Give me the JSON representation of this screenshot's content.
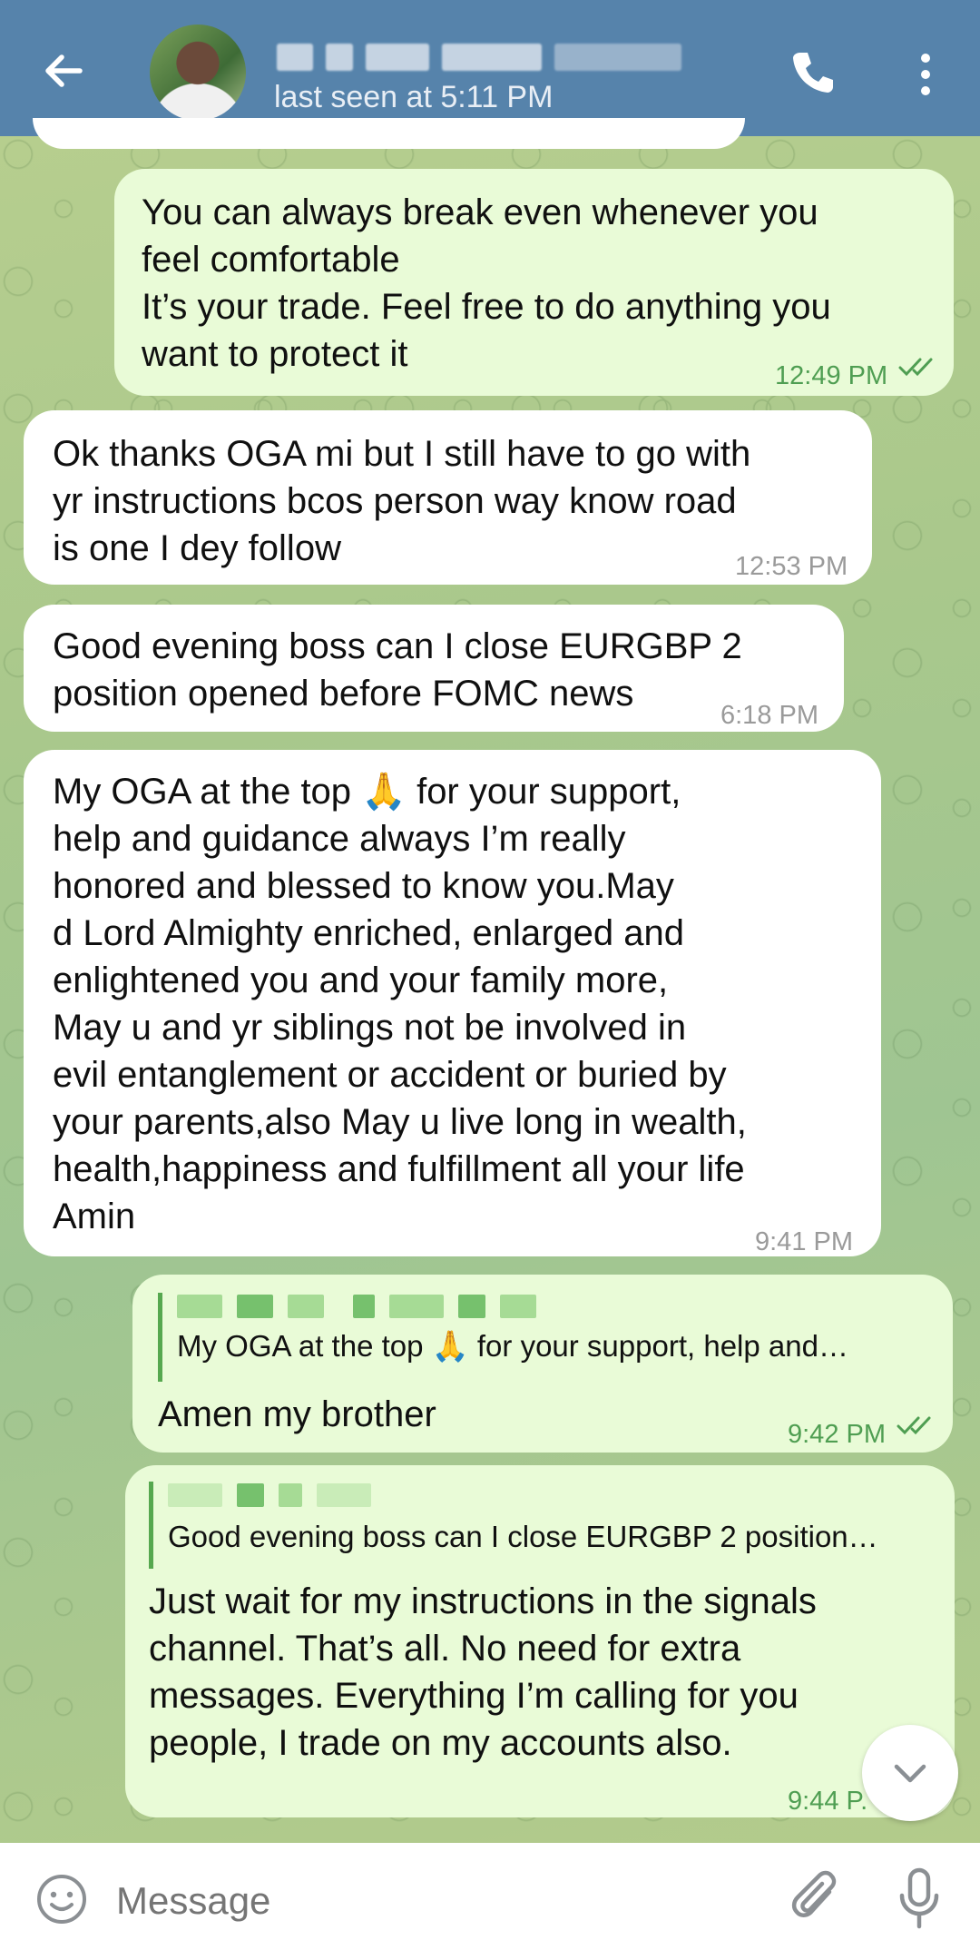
{
  "header": {
    "status": "last seen at 5:11 PM"
  },
  "messages": [
    {
      "text": "You can always break even whenever you\nfeel comfortable\nIt’s your trade. Feel free to do anything you\nwant to protect it",
      "time": "12:49 PM"
    },
    {
      "text": "Ok thanks OGA mi but I still have to go with\nyr instructions bcos person way know road\nis one I dey follow",
      "time": "12:53 PM"
    },
    {
      "text": "Good evening boss can I close EURGBP 2\nposition opened before FOMC news",
      "time": "6:18 PM"
    },
    {
      "text": "My OGA at the top 🙏 for your support,\nhelp and guidance always I’m really\nhonored and blessed to know you.May\nd Lord Almighty enriched, enlarged and\nenlightened you and your family more,\nMay u and yr siblings not be involved in\nevil entanglement or accident or buried by\nyour parents,also May u live long in wealth,\nhealth,happiness and fulfillment all your life\nAmin",
      "time": "9:41 PM"
    },
    {
      "reply": "My OGA at the top 🙏 for your support, help and…",
      "text": "Amen my brother",
      "time": "9:42 PM"
    },
    {
      "reply": "Good evening boss can I close EURGBP 2 position…",
      "text": "Just wait for my instructions in the signals\nchannel. That’s all. No need for extra\nmessages. Everything I’m calling for you\npeople, I trade on my accounts also.",
      "time": "9:44 P."
    }
  ],
  "input": {
    "placeholder": "Message"
  },
  "icons": [
    "back-arrow-icon",
    "phone-icon",
    "more-vertical-icon",
    "double-check-icon",
    "chevron-down-icon",
    "emoji-icon",
    "paperclip-icon",
    "microphone-icon"
  ],
  "colors": {
    "header": "#5683ab",
    "outgoing_bubble": "#e9fbd7",
    "incoming_bubble": "#ffffff",
    "outgoing_time": "#4f9e52"
  }
}
